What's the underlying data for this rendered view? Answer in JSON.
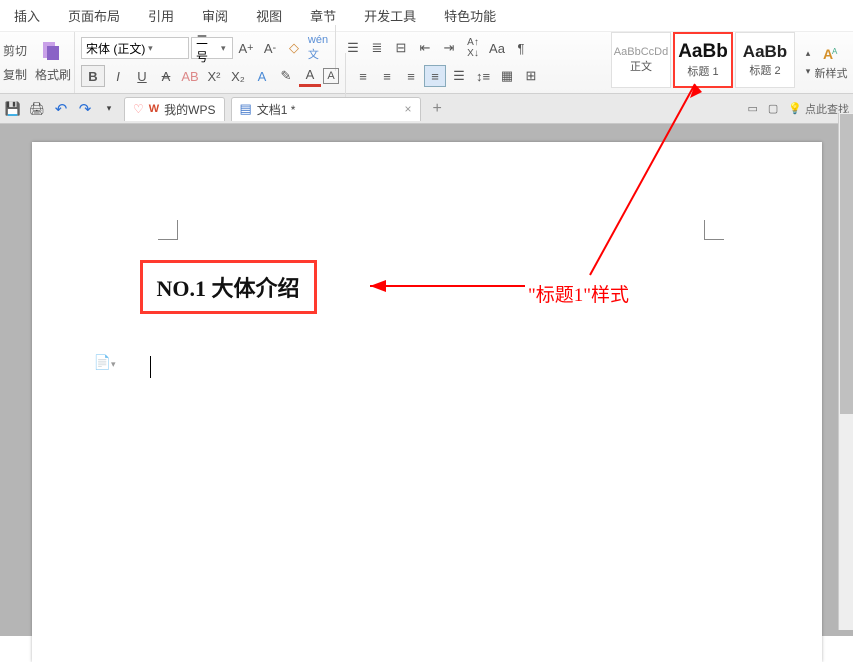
{
  "menu": [
    "插入",
    "页面布局",
    "引用",
    "审阅",
    "视图",
    "章节",
    "开发工具",
    "特色功能"
  ],
  "side": {
    "cut": "剪切",
    "copy": "复制",
    "fmt": "格式刷"
  },
  "font": {
    "name": "宋体 (正文)",
    "size": "二号"
  },
  "styles": {
    "body": {
      "prev": "AaBbCcDd",
      "label": "正文"
    },
    "h1": {
      "prev": "AaBb",
      "label": "标题 1"
    },
    "h2": {
      "prev": "AaBb",
      "label": "标题 2"
    }
  },
  "new_style": "新样式",
  "tabs": {
    "home": "我的WPS",
    "doc": "文档1 *"
  },
  "status": "点此查找",
  "heading": "NO.1 大体介绍",
  "annot": "\"标题1\"样式"
}
